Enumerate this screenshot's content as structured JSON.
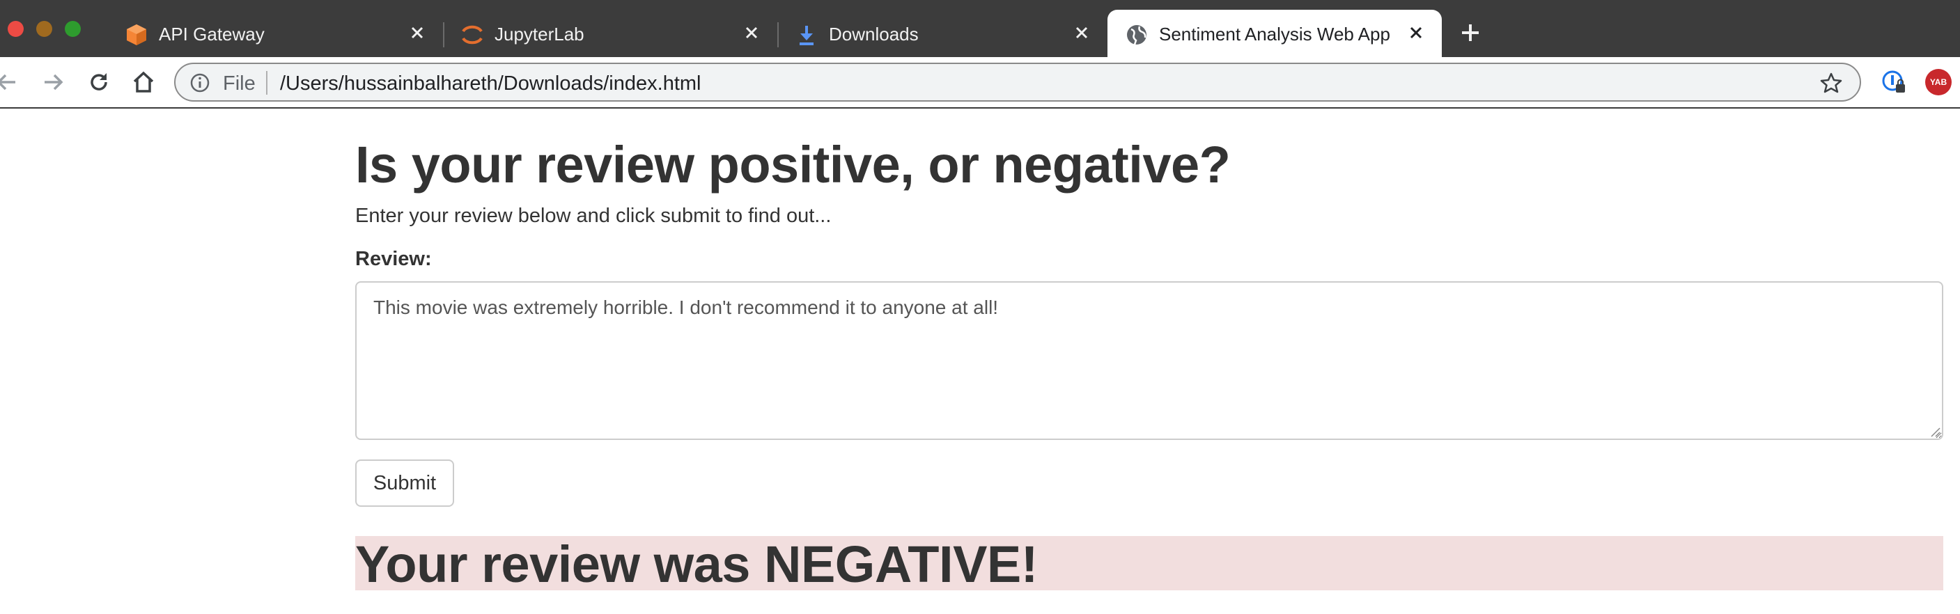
{
  "browser": {
    "tabs": [
      {
        "title": "API Gateway",
        "icon": "aws-cube-icon",
        "active": false
      },
      {
        "title": "JupyterLab",
        "icon": "jupyter-icon",
        "active": false
      },
      {
        "title": "Downloads",
        "icon": "download-icon",
        "active": false
      },
      {
        "title": "Sentiment Analysis Web App",
        "icon": "globe-icon",
        "active": true
      }
    ],
    "address": {
      "scheme": "File",
      "url": "/Users/hussainbalhareth/Downloads/index.html"
    },
    "extensions": {
      "yab_label": "YAB"
    }
  },
  "page": {
    "title": "Is your review positive, or negative?",
    "intro": "Enter your review below and click submit to find out...",
    "review_label": "Review:",
    "review_value": "This movie was extremely horrible. I don't recommend it to anyone at all!",
    "submit_label": "Submit",
    "result": "Your review was NEGATIVE!"
  },
  "colors": {
    "tabbar": "#3c3c3c",
    "result_background": "#f2dede",
    "text": "#333333"
  }
}
